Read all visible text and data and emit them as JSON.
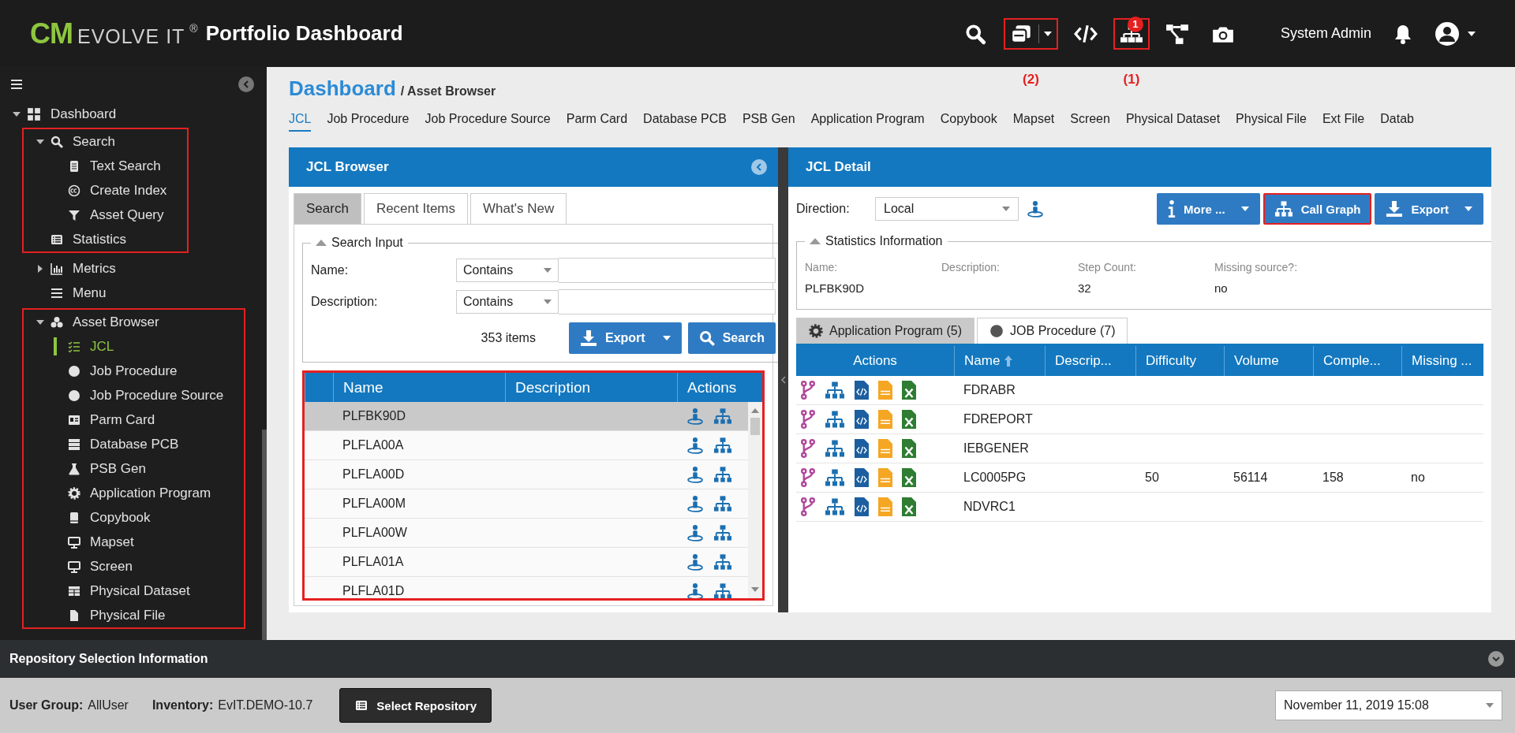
{
  "header": {
    "logo": {
      "mark": "CM",
      "name": "EVOLVE IT",
      "symbol": "®"
    },
    "title": "Portfolio Dashboard",
    "tools": [
      {
        "kind": "search",
        "highlighted": false
      },
      {
        "kind": "windows",
        "dropdown": true,
        "highlighted": true,
        "annotation": "(2)"
      },
      {
        "kind": "code",
        "highlighted": false
      },
      {
        "kind": "orgchart",
        "badge": "1",
        "highlighted": true,
        "annotation": "(1)"
      },
      {
        "kind": "flow",
        "highlighted": false
      },
      {
        "kind": "camera",
        "highlighted": false
      }
    ],
    "user": "System Admin"
  },
  "sidebar": {
    "root": {
      "label": "Dashboard",
      "kind": "grid",
      "expanded": true,
      "sections": [
        {
          "highlighted": true,
          "items": [
            {
              "label": "Search",
              "kind": "search",
              "expanded": true,
              "children": [
                {
                  "label": "Text Search",
                  "kind": "doc"
                },
                {
                  "label": "Create Index",
                  "kind": "cc"
                },
                {
                  "label": "Asset Query",
                  "kind": "filter"
                }
              ]
            },
            {
              "label": "Statistics",
              "kind": "list"
            }
          ]
        },
        {
          "highlighted": false,
          "items": [
            {
              "label": "Metrics",
              "kind": "chart",
              "expanded": false
            },
            {
              "label": "Menu",
              "kind": "menu"
            }
          ]
        },
        {
          "highlighted": true,
          "items": [
            {
              "label": "Asset Browser",
              "kind": "cubes",
              "expanded": true,
              "children": [
                {
                  "label": "JCL",
                  "kind": "checklist",
                  "selected": true
                },
                {
                  "label": "Job Procedure",
                  "kind": "circle",
                  "selected": false
                },
                {
                  "label": "Job Procedure Source",
                  "kind": "circle",
                  "selected": false
                },
                {
                  "label": "Parm Card",
                  "kind": "idcard",
                  "selected": false
                },
                {
                  "label": "Database PCB",
                  "kind": "server",
                  "selected": false
                },
                {
                  "label": "PSB Gen",
                  "kind": "flask",
                  "selected": false
                },
                {
                  "label": "Application Program",
                  "kind": "gear",
                  "selected": false
                },
                {
                  "label": "Copybook",
                  "kind": "book",
                  "selected": false
                },
                {
                  "label": "Mapset",
                  "kind": "monitor",
                  "selected": false
                },
                {
                  "label": "Screen",
                  "kind": "monitor",
                  "selected": false
                },
                {
                  "label": "Physical Dataset",
                  "kind": "table",
                  "selected": false
                },
                {
                  "label": "Physical File",
                  "kind": "file",
                  "selected": false
                }
              ]
            }
          ]
        }
      ]
    }
  },
  "breadcrumb": {
    "link": "Dashboard",
    "current": "/ Asset Browser"
  },
  "asset_tabs": [
    {
      "label": "JCL",
      "selected": true
    },
    {
      "label": "Job Procedure",
      "selected": false
    },
    {
      "label": "Job Procedure Source",
      "selected": false
    },
    {
      "label": "Parm Card",
      "selected": false
    },
    {
      "label": "Database PCB",
      "selected": false
    },
    {
      "label": "PSB Gen",
      "selected": false
    },
    {
      "label": "Application Program",
      "selected": false
    },
    {
      "label": "Copybook",
      "selected": false
    },
    {
      "label": "Mapset",
      "selected": false
    },
    {
      "label": "Screen",
      "selected": false
    },
    {
      "label": "Physical Dataset",
      "selected": false
    },
    {
      "label": "Physical File",
      "selected": false
    },
    {
      "label": "Ext File",
      "selected": false
    },
    {
      "label": "Datab",
      "selected": false
    }
  ],
  "browser": {
    "title": "JCL Browser",
    "tabs": [
      {
        "label": "Search",
        "selected": true
      },
      {
        "label": "Recent Items",
        "selected": false
      },
      {
        "label": "What's New",
        "selected": false
      }
    ],
    "search_input": {
      "legend": "Search Input",
      "fields": [
        {
          "label": "Name:",
          "operator": "Contains"
        },
        {
          "label": "Description:",
          "operator": "Contains"
        }
      ],
      "count": "353 items",
      "export_button": "Export",
      "search_button": "Search"
    },
    "table": {
      "highlighted": true,
      "columns": [
        "Name",
        "Description",
        "Actions"
      ],
      "rows": [
        {
          "name": "PLFBK90D",
          "selected": true
        },
        {
          "name": "PLFLA00A",
          "selected": false
        },
        {
          "name": "PLFLA00D",
          "selected": false
        },
        {
          "name": "PLFLA00M",
          "selected": false
        },
        {
          "name": "PLFLA00W",
          "selected": false
        },
        {
          "name": "PLFLA01A",
          "selected": false
        },
        {
          "name": "PLFLA01D",
          "selected": false
        }
      ]
    }
  },
  "detail": {
    "title": "JCL Detail",
    "direction_label": "Direction:",
    "direction": "Local",
    "buttons": [
      {
        "label": "More ...",
        "kind": "info",
        "dropdown": true,
        "highlighted": false
      },
      {
        "label": "Call Graph",
        "kind": "graph",
        "dropdown": false,
        "highlighted": true
      },
      {
        "label": "Export",
        "kind": "export",
        "dropdown": true,
        "highlighted": false
      }
    ],
    "statistics": {
      "legend": "Statistics Information",
      "fields": [
        {
          "label": "Name:",
          "value": "PLFBK90D"
        },
        {
          "label": "Description:"
        },
        {
          "label": "Step Count:",
          "value": "32"
        },
        {
          "label": "Missing source?:",
          "value": "no"
        }
      ]
    },
    "tabs": [
      {
        "label": "Application Program (5)",
        "kind": "gear",
        "selected": true
      },
      {
        "label": "JOB Procedure (7)",
        "kind": "circle",
        "selected": false
      }
    ],
    "table": {
      "columns": [
        {
          "label": "Actions",
          "sorted": false
        },
        {
          "label": "Name",
          "sorted": true
        },
        {
          "label": "Descrip...",
          "sorted": false
        },
        {
          "label": "Difficulty",
          "sorted": false
        },
        {
          "label": "Volume",
          "sorted": false
        },
        {
          "label": "Comple...",
          "sorted": false
        },
        {
          "label": "Missing ...",
          "sorted": false
        }
      ],
      "rows": [
        {
          "cells": [
            "",
            "FDRABR",
            "",
            "",
            "",
            "",
            ""
          ]
        },
        {
          "cells": [
            "",
            "FDREPORT",
            "",
            "",
            "",
            "",
            ""
          ]
        },
        {
          "cells": [
            "",
            "IEBGENER",
            "",
            "",
            "",
            "",
            ""
          ]
        },
        {
          "cells": [
            "",
            "LC0005PG",
            "",
            "50",
            "56114",
            "158",
            "no"
          ]
        },
        {
          "cells": [
            "",
            "NDVRC1",
            "",
            "",
            "",
            "",
            ""
          ]
        }
      ]
    }
  },
  "repository": {
    "title": "Repository Selection Information",
    "user_group_label": "User Group:",
    "user_group": "AllUser",
    "inventory_label": "Inventory:",
    "inventory": "EvIT.DEMO-10.7",
    "button": "Select Repository",
    "date": "November 11, 2019 15:08"
  }
}
